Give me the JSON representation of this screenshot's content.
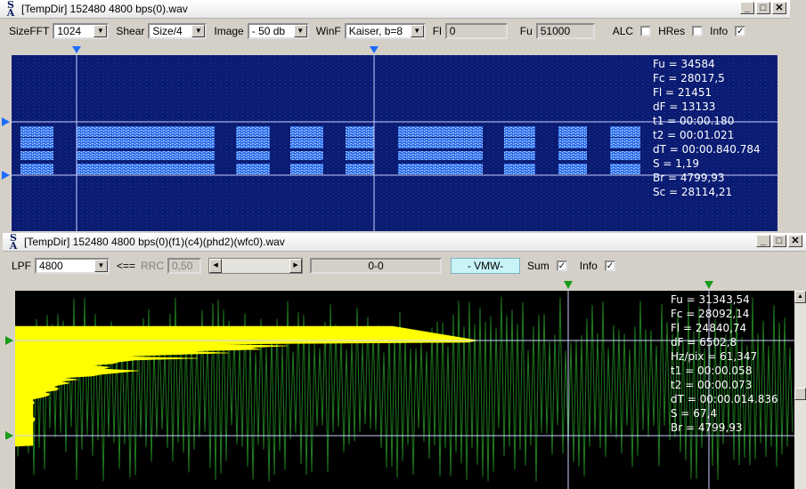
{
  "window1": {
    "title": "[TempDir] 152480 4800 bps(0).wav",
    "toolbar": {
      "sizefft_label": "SizeFFT",
      "sizefft_value": "1024",
      "shear_label": "Shear",
      "shear_value": "Size/4",
      "image_label": "Image",
      "image_value": "- 50 db",
      "winf_label": "WinF",
      "winf_value": "Kaiser, b=8",
      "fl_label": "Fl",
      "fl_value": "0",
      "fu_label": "Fu",
      "fu_value": "51000",
      "alc_label": "ALC",
      "alc_checked": false,
      "hres_label": "HRes",
      "hres_checked": false,
      "info_label": "Info",
      "info_checked": true
    },
    "info_lines": [
      "Fu = 34584",
      "Fc = 28017,5",
      "Fl = 21451",
      "dF = 13133",
      "t1 = 00:00.180",
      "t2 = 00:01.021",
      "dT = 00:00.840.784",
      "S = 1,19",
      "Br = 4799,93",
      "Sc = 28114,21"
    ]
  },
  "window2": {
    "title": "[TempDir] 152480 4800 bps(0)(f1)(c4)(phd2)(wfc0).wav",
    "toolbar": {
      "lpf_label": "LPF",
      "lpf_value": "4800",
      "arrow_label": "<==",
      "rrc_label": "RRC",
      "rrc_value": "0,50",
      "range_text": "0-0",
      "mode_text": "- VMW-",
      "sum_label": "Sum",
      "sum_checked": true,
      "info_label": "Info",
      "info_checked": true
    },
    "info_lines": [
      "Fu = 31343,54",
      "Fc = 28092,14",
      "Fl = 24840,74",
      "dF = 6502,8",
      "Hz/pix = 61,347",
      "t1 = 00:00.058",
      "t2 = 00:00.073",
      "dT = 00:00.014.836",
      "S = 67,4",
      "Br = 4799,93"
    ]
  },
  "icons": {
    "logo": "sa-logo-icon",
    "minimize": "minimize-icon",
    "maximize": "maximize-icon",
    "close": "close-icon"
  },
  "colors": {
    "spectrum_bg": "#0a1a6e",
    "signal": "#4f8cff",
    "cursor": "#c8d0ff",
    "marker": "#1e6cff",
    "waveform": "#1f7a1f",
    "fill": "#ffff00",
    "marker_green": "#1a9a1a"
  }
}
